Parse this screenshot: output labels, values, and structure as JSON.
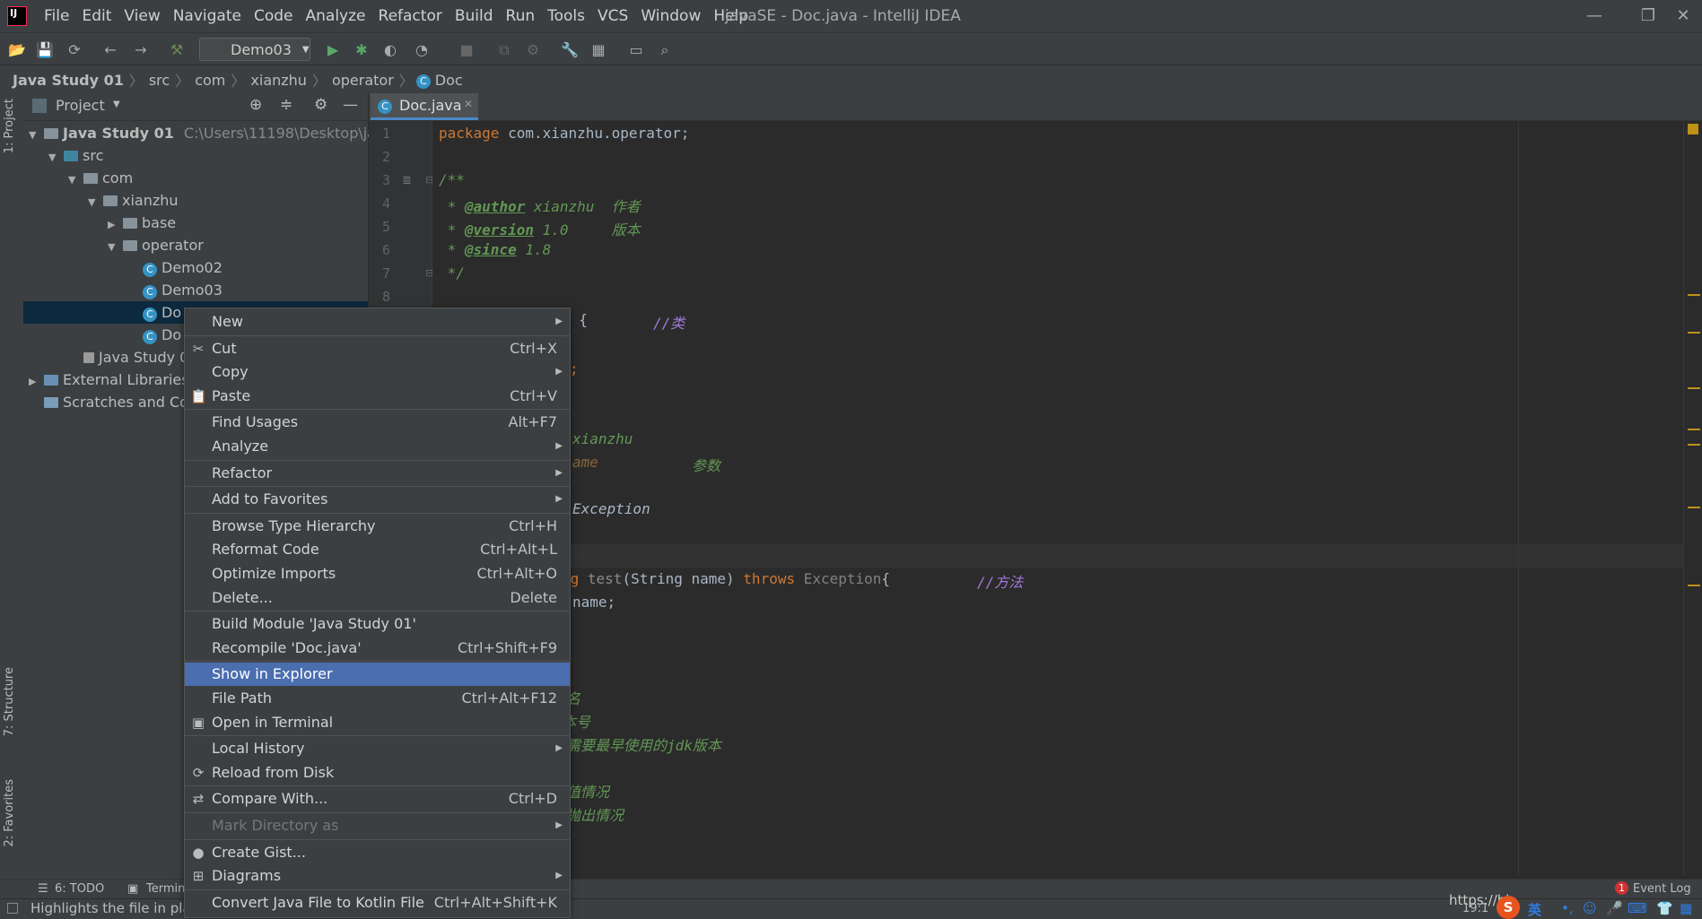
{
  "app": {
    "window_title": "javaSE - Doc.java - IntelliJ IDEA",
    "menu": [
      "File",
      "Edit",
      "View",
      "Navigate",
      "Code",
      "Analyze",
      "Refactor",
      "Build",
      "Run",
      "Tools",
      "VCS",
      "Window",
      "Help"
    ]
  },
  "toolbar": {
    "run_config": "Demo03"
  },
  "breadcrumb": [
    "Java Study 01",
    "src",
    "com",
    "xianzhu",
    "operator",
    "Doc"
  ],
  "left_strip": {
    "project": "1: Project",
    "structure": "7: Structure",
    "favorites": "2: Favorites"
  },
  "project_panel": {
    "title": "Project",
    "root_name": "Java Study 01",
    "root_path": "C:\\Users\\11198\\Desktop\\java",
    "tree": [
      {
        "label": "src",
        "indent": 1,
        "type": "folder-blue",
        "arrow": "▼"
      },
      {
        "label": "com",
        "indent": 2,
        "type": "folder",
        "arrow": "▼"
      },
      {
        "label": "xianzhu",
        "indent": 3,
        "type": "folder",
        "arrow": "▼"
      },
      {
        "label": "base",
        "indent": 4,
        "type": "folder",
        "arrow": "▶"
      },
      {
        "label": "operator",
        "indent": 4,
        "type": "folder",
        "arrow": "▼"
      },
      {
        "label": "Demo02",
        "indent": 5,
        "type": "class",
        "arrow": ""
      },
      {
        "label": "Demo03",
        "indent": 5,
        "type": "class",
        "arrow": ""
      },
      {
        "label": "Do",
        "indent": 5,
        "type": "class",
        "arrow": "",
        "selected": true
      },
      {
        "label": "Do",
        "indent": 5,
        "type": "class",
        "arrow": ""
      },
      {
        "label": "Java Study 01.i",
        "indent": 2,
        "type": "file",
        "arrow": ""
      },
      {
        "label": "External Libraries",
        "indent": 0,
        "type": "lib",
        "arrow": "▶"
      },
      {
        "label": "Scratches and Co",
        "indent": 0,
        "type": "scratch",
        "arrow": ""
      }
    ]
  },
  "editor": {
    "tab": "Doc.java",
    "line_numbers": [
      "1",
      "2",
      "3",
      "4",
      "5",
      "6",
      "7",
      "8"
    ],
    "code": {
      "l1_kw": "package",
      "l1_rest": " com.xianzhu.operator;",
      "l3": "/**",
      "l4_star": " * ",
      "l4_tag": "@author",
      "l4_val": " xianzhu  作者",
      "l5_tag": "@version",
      "l5_val": " 1.0     版本",
      "l6_tag": "@since",
      "l6_val": " 1.8",
      "l7": " */",
      "l9_frag": "c {",
      "l9_cm": "//类",
      "l11_frag": ";",
      "l14_frag": "xianzhu",
      "l15_frag": "ame",
      "l15_cm": "参数",
      "l17_frag": "Exception",
      "l20_a": "ng ",
      "l20_b": "test",
      "l20_c": "(String name) ",
      "l20_kw": "throws",
      "l20_d": " Exception",
      "l20_e": "{",
      "l20_cm": "//方法",
      "l21_frag": "name;",
      "l25": "名",
      "l26": "本号",
      "l27": "需要最早使用的jdk版本",
      "l29": "值情况",
      "l30": "抛出情况"
    }
  },
  "context_menu": [
    {
      "label": "New",
      "shortcut": "",
      "submenu": true,
      "icon": ""
    },
    {
      "sep": true
    },
    {
      "label": "Cut",
      "shortcut": "Ctrl+X",
      "icon": "✂"
    },
    {
      "label": "Copy",
      "shortcut": "",
      "submenu": true,
      "icon": ""
    },
    {
      "label": "Paste",
      "shortcut": "Ctrl+V",
      "icon": "📋"
    },
    {
      "sep": true
    },
    {
      "label": "Find Usages",
      "shortcut": "Alt+F7",
      "icon": ""
    },
    {
      "label": "Analyze",
      "shortcut": "",
      "submenu": true,
      "icon": ""
    },
    {
      "sep": true
    },
    {
      "label": "Refactor",
      "shortcut": "",
      "submenu": true,
      "icon": ""
    },
    {
      "sep": true
    },
    {
      "label": "Add to Favorites",
      "shortcut": "",
      "submenu": true,
      "icon": ""
    },
    {
      "sep": true
    },
    {
      "label": "Browse Type Hierarchy",
      "shortcut": "Ctrl+H",
      "icon": ""
    },
    {
      "label": "Reformat Code",
      "shortcut": "Ctrl+Alt+L",
      "icon": ""
    },
    {
      "label": "Optimize Imports",
      "shortcut": "Ctrl+Alt+O",
      "icon": ""
    },
    {
      "label": "Delete...",
      "shortcut": "Delete",
      "icon": ""
    },
    {
      "sep": true
    },
    {
      "label": "Build Module 'Java Study 01'",
      "shortcut": "",
      "icon": ""
    },
    {
      "label": "Recompile 'Doc.java'",
      "shortcut": "Ctrl+Shift+F9",
      "icon": ""
    },
    {
      "sep": true
    },
    {
      "label": "Show in Explorer",
      "shortcut": "",
      "icon": "",
      "highlight": true
    },
    {
      "label": "File Path",
      "shortcut": "Ctrl+Alt+F12",
      "icon": ""
    },
    {
      "label": "Open in Terminal",
      "shortcut": "",
      "icon": "▣"
    },
    {
      "sep": true
    },
    {
      "label": "Local History",
      "shortcut": "",
      "submenu": true,
      "icon": ""
    },
    {
      "label": "Reload from Disk",
      "shortcut": "",
      "icon": "⟳"
    },
    {
      "sep": true
    },
    {
      "label": "Compare With...",
      "shortcut": "Ctrl+D",
      "icon": "⇄"
    },
    {
      "sep": true
    },
    {
      "label": "Mark Directory as",
      "shortcut": "",
      "submenu": true,
      "icon": "",
      "disabled": true
    },
    {
      "sep": true
    },
    {
      "label": "Create Gist...",
      "shortcut": "",
      "icon": "●"
    },
    {
      "label": "Diagrams",
      "shortcut": "",
      "submenu": true,
      "icon": "⊞"
    },
    {
      "sep": true
    },
    {
      "label": "Convert Java File to Kotlin File",
      "shortcut": "Ctrl+Alt+Shift+K",
      "icon": ""
    }
  ],
  "bottom": {
    "todo": "6: TODO",
    "terminal": "Termin",
    "event_log": "Event Log",
    "event_count": "1",
    "status_text": "Highlights the file in pla",
    "url_fragment": "https://bl",
    "position": "19:1",
    "ime": "英"
  }
}
